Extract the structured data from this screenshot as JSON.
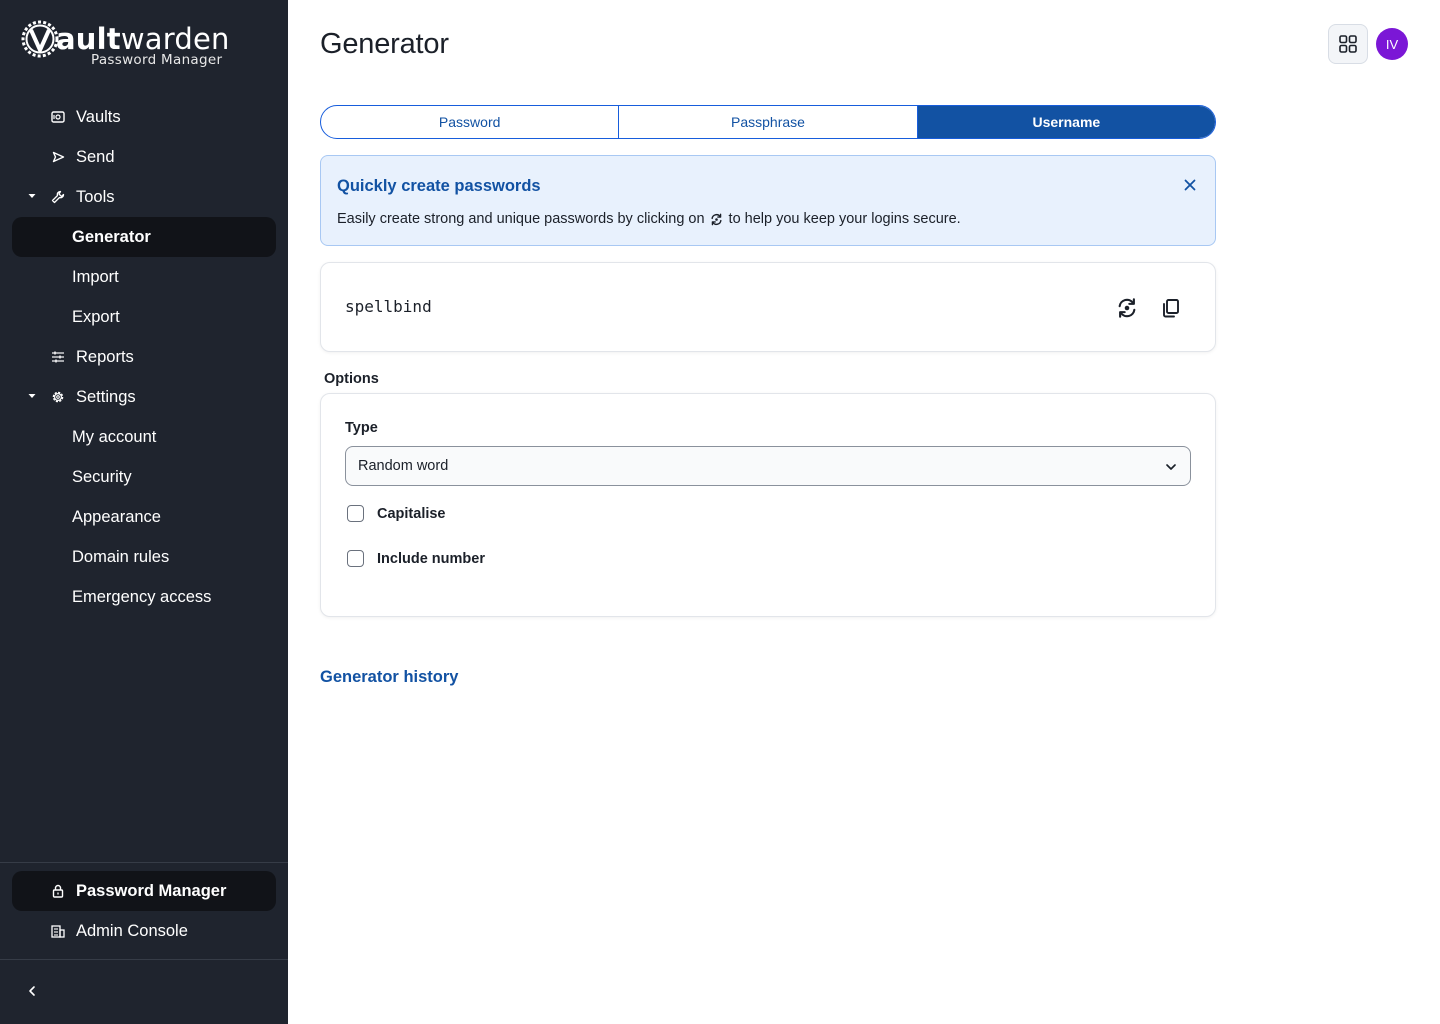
{
  "sidebar": {
    "logo": {
      "word_bold": "ault",
      "word_rest": "warden",
      "subtitle": "Password Manager"
    },
    "nav": {
      "vaults": "Vaults",
      "send": "Send",
      "tools": "Tools",
      "generator": "Generator",
      "import": "Import",
      "export": "Export",
      "reports": "Reports",
      "settings": "Settings",
      "my_account": "My account",
      "security": "Security",
      "appearance": "Appearance",
      "domain_rules": "Domain rules",
      "emergency_access": "Emergency access"
    },
    "products": {
      "password_manager": "Password Manager",
      "admin_console": "Admin Console"
    }
  },
  "header": {
    "title": "Generator",
    "avatar_initials": "IV"
  },
  "generator": {
    "tabs": [
      {
        "label": "Password",
        "selected": false
      },
      {
        "label": "Passphrase",
        "selected": false
      },
      {
        "label": "Username",
        "selected": true
      }
    ],
    "callout": {
      "title": "Quickly create passwords",
      "body_before": "Easily create strong and unique passwords by clicking on",
      "body_after": "to help you keep your logins secure."
    },
    "result_value": "spellbind",
    "options_heading": "Options",
    "type_label": "Type",
    "type_value": "Random word",
    "checkboxes": {
      "capitalise": {
        "label": "Capitalise",
        "checked": false
      },
      "include_number": {
        "label": "Include number",
        "checked": false
      }
    },
    "history_link": "Generator history"
  },
  "colors": {
    "sidebar_bg": "#1f242e",
    "primary": "#1252a3",
    "avatar": "#7b17d6",
    "callout_bg": "#e8f1fd"
  },
  "icons": [
    "vault-icon",
    "send-icon",
    "wrench-icon",
    "sliders-icon",
    "gear-icon",
    "lock-icon",
    "building-icon",
    "chevron-left-icon",
    "grid-icon",
    "close-icon",
    "regenerate-icon",
    "copy-icon",
    "chevron-down-icon"
  ]
}
